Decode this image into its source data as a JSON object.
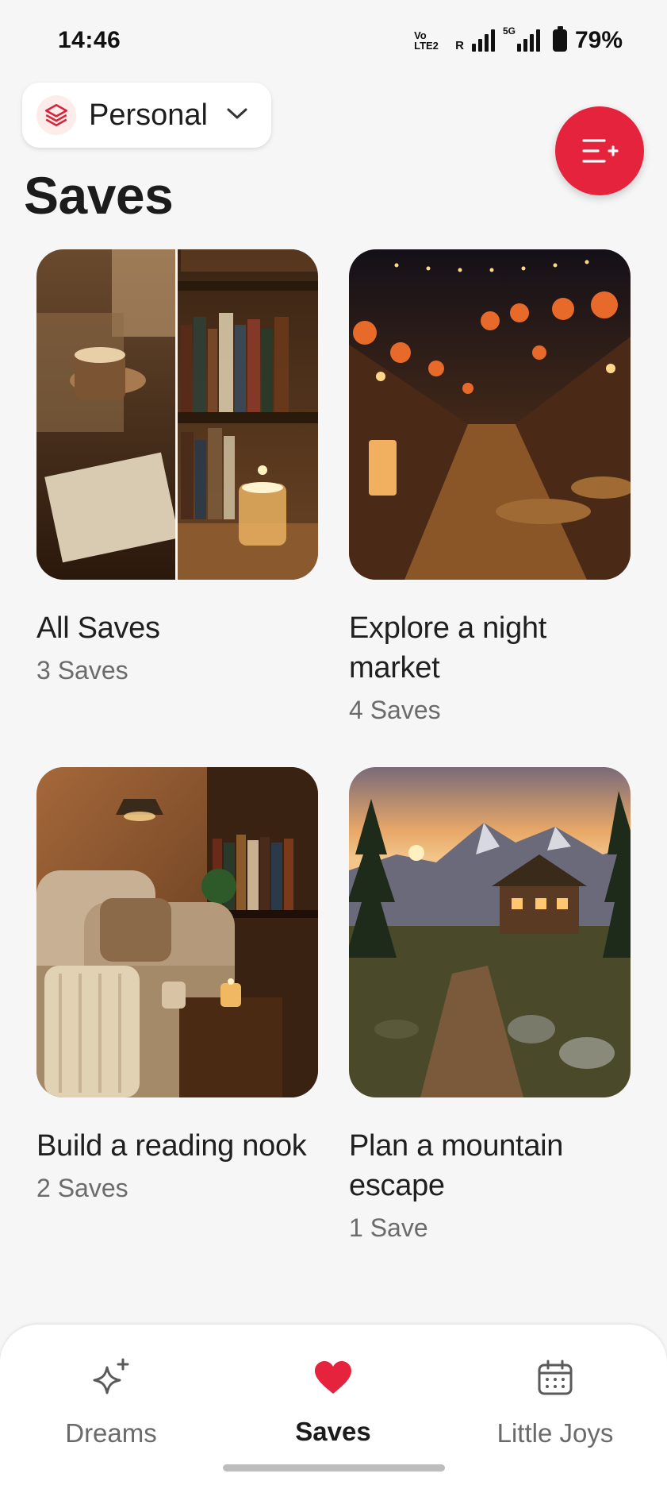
{
  "status_bar": {
    "time": "14:46",
    "volte": "Vo\nLTE2",
    "roaming": "R",
    "network": "5G",
    "battery": "79%"
  },
  "workspace": {
    "label": "Personal"
  },
  "page": {
    "title": "Saves"
  },
  "collections": [
    {
      "title": "All Saves",
      "count": "3 Saves"
    },
    {
      "title": "Explore a night market",
      "count": "4 Saves"
    },
    {
      "title": "Build a reading nook",
      "count": "2 Saves"
    },
    {
      "title": "Plan a mountain escape",
      "count": "1 Save"
    }
  ],
  "nav": {
    "items": [
      {
        "label": "Dreams",
        "icon": "sparkles-icon"
      },
      {
        "label": "Saves",
        "icon": "heart-icon"
      },
      {
        "label": "Little Joys",
        "icon": "calendar-icon"
      }
    ],
    "active": "Saves"
  },
  "colors": {
    "accent": "#e5233c",
    "background": "#f6f6f6"
  }
}
